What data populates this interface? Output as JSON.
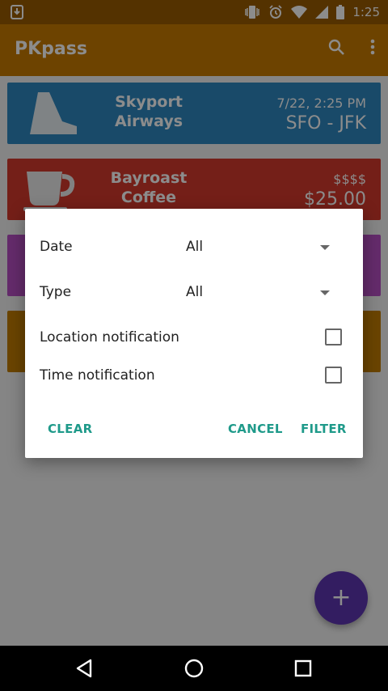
{
  "status": {
    "time": "1:25"
  },
  "appbar": {
    "title": "PKpass",
    "search_icon": "search-icon",
    "more_icon": "more-vert-icon"
  },
  "cards": [
    {
      "name": "Skyport Airways",
      "line1": "7/22, 2:25 PM",
      "line2": "SFO - JFK",
      "color": "#2f88bf",
      "icon": "airplane-tail-icon"
    },
    {
      "name": "Bayroast Coffee",
      "line1": "$$$$",
      "line2": "$25.00",
      "color": "#d33a2c",
      "icon": "coffee-cup-icon"
    },
    {
      "name": "",
      "line1": "",
      "line2": "",
      "color": "#b64fc4",
      "icon": ""
    },
    {
      "name": "",
      "line1": "",
      "line2": "",
      "color": "#c27c00",
      "icon": ""
    }
  ],
  "dialog": {
    "date_label": "Date",
    "date_value": "All",
    "type_label": "Type",
    "type_value": "All",
    "location_label": "Location notification",
    "time_label": "Time notification",
    "clear": "CLEAR",
    "cancel": "CANCEL",
    "filter": "FILTER"
  },
  "colors": {
    "accent": "#1f9a8a",
    "fab": "#5e35b1",
    "appbar": "#c77b00"
  }
}
